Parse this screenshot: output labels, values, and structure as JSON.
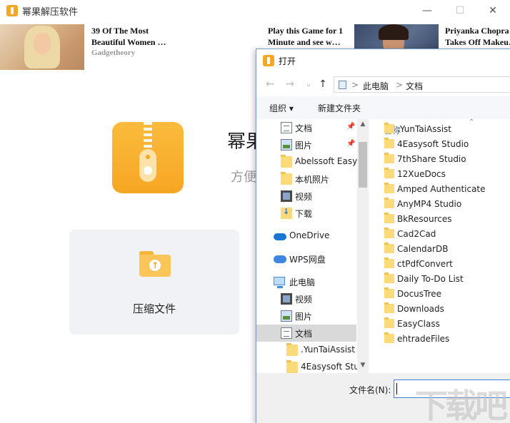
{
  "app": {
    "title": "幂果解压软件",
    "name_partial": "幂果",
    "tagline_partial": "方便",
    "compress_label": "压缩文件",
    "window_controls": {
      "minimize": "—",
      "maximize": "☐",
      "close": "✕"
    },
    "accent_color": "#f5a623"
  },
  "ads": [
    {
      "title": "39 Of The Most Beautiful Women …",
      "source": "Gadgetheory"
    },
    {
      "title": "Play this Game for 1 Minute and see w…"
    },
    {
      "title": "Priyanka Chopra Takes Off Makeu…"
    }
  ],
  "dialog": {
    "title": "打开",
    "nav": {
      "back": "←",
      "forward": "→",
      "dropdown": "⌄",
      "up": "↑"
    },
    "breadcrumb": [
      "此电脑",
      "文档"
    ],
    "breadcrumb_separator": ">",
    "toolbar": {
      "organize": "组织 ▾",
      "new_folder": "新建文件夹"
    },
    "nav_items": [
      {
        "label": "文档",
        "icon": "document-icon",
        "pinned": true
      },
      {
        "label": "图片",
        "icon": "picture-icon",
        "pinned": true
      },
      {
        "label": "Abelssoft Easy",
        "icon": "folder-icon"
      },
      {
        "label": "本机照片",
        "icon": "folder-icon"
      },
      {
        "label": "视频",
        "icon": "video-icon"
      },
      {
        "label": "下载",
        "icon": "download-icon"
      },
      {
        "label": "OneDrive",
        "icon": "cloud-icon"
      },
      {
        "label": "WPS网盘",
        "icon": "wps-cloud-icon"
      },
      {
        "label": "此电脑",
        "icon": "computer-icon"
      },
      {
        "label": "视频",
        "icon": "video-icon"
      },
      {
        "label": "图片",
        "icon": "picture-icon"
      },
      {
        "label": "文档",
        "icon": "document-icon",
        "selected": true
      },
      {
        "label": ".YunTaiAssist",
        "icon": "folder-icon"
      },
      {
        "label": "4Easysoft Stu",
        "icon": "folder-icon"
      }
    ],
    "pin_glyph": "📌",
    "column_header": "名称",
    "sort_glyph": "⌃",
    "files": [
      ".YunTaiAssist",
      "4Easysoft Studio",
      "7thShare Studio",
      "12XueDocs",
      "Amped Authenticate",
      "AnyMP4 Studio",
      "BkResources",
      "Cad2Cad",
      "CalendarDB",
      "ctPdfConvert",
      "Daily To-Do List",
      "DocusTree",
      "Downloads",
      "EasyClass",
      "ehtradeFiles"
    ],
    "filename_label": "文件名(N):",
    "filename_value": "",
    "scroll_up": "▲",
    "scroll_down": "▼"
  },
  "watermark": "下载吧"
}
